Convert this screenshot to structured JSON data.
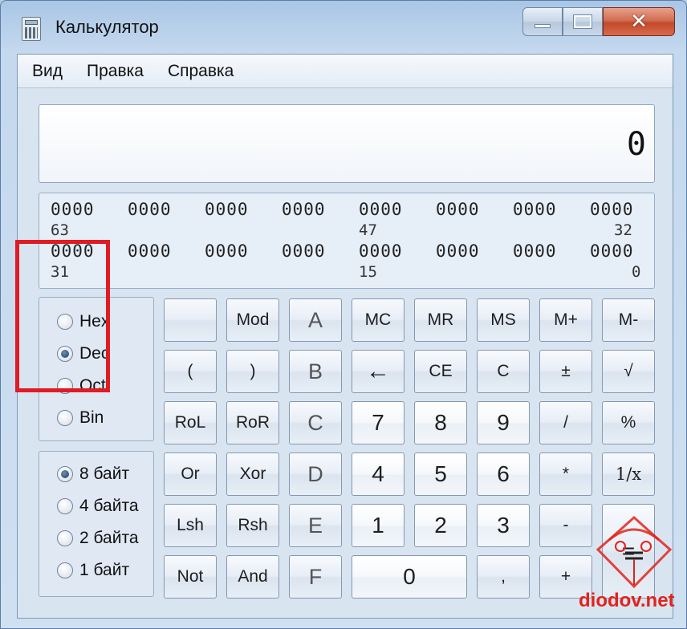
{
  "window": {
    "title": "Калькулятор"
  },
  "menu": [
    "Вид",
    "Правка",
    "Справка"
  ],
  "display": {
    "value": "0"
  },
  "bits": {
    "row1": [
      "0000",
      "0000",
      "0000",
      "0000",
      "0000",
      "0000",
      "0000",
      "0000"
    ],
    "row1_labels": [
      "63",
      "47",
      "32"
    ],
    "row2": [
      "0000",
      "0000",
      "0000",
      "0000",
      "0000",
      "0000",
      "0000",
      "0000"
    ],
    "row2_labels": [
      "31",
      "15",
      "0"
    ]
  },
  "base_radios": [
    {
      "label": "Hex",
      "selected": false
    },
    {
      "label": "Dec",
      "selected": true
    },
    {
      "label": "Oct",
      "selected": false
    },
    {
      "label": "Bin",
      "selected": false
    }
  ],
  "size_radios": [
    {
      "label": "8 байт",
      "selected": true
    },
    {
      "label": "4 байта",
      "selected": false
    },
    {
      "label": "2 байта",
      "selected": false
    },
    {
      "label": "1 байт",
      "selected": false
    }
  ],
  "keys": {
    "r1": [
      "",
      "Mod",
      "A",
      "MC",
      "MR",
      "MS",
      "M+",
      "M-"
    ],
    "r2": [
      "(",
      ")",
      "B",
      "←",
      "CE",
      "C",
      "±",
      "√"
    ],
    "r3": [
      "RoL",
      "RoR",
      "C",
      "7",
      "8",
      "9",
      "/",
      "%"
    ],
    "r4": [
      "Or",
      "Xor",
      "D",
      "4",
      "5",
      "6",
      "*",
      "1/x"
    ],
    "r5": [
      "Lsh",
      "Rsh",
      "E",
      "1",
      "2",
      "3",
      "-",
      "="
    ],
    "r6": [
      "Not",
      "And",
      "F",
      "0",
      ",",
      "+"
    ]
  },
  "watermark": {
    "text": "diodov.net"
  }
}
